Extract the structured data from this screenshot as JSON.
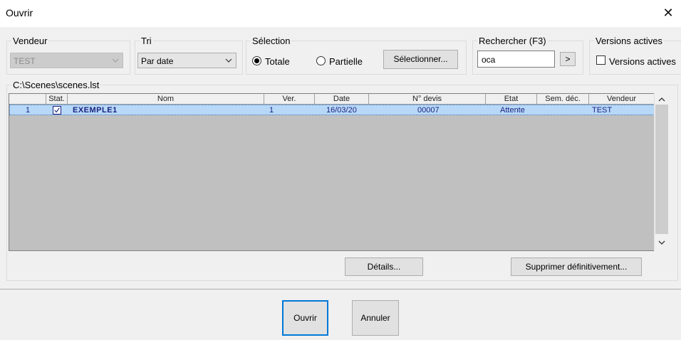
{
  "window": {
    "title": "Ouvrir"
  },
  "vendeur": {
    "label": "Vendeur",
    "value": "TEST"
  },
  "tri": {
    "label": "Tri",
    "value": "Par date"
  },
  "selection": {
    "label": "Sélection",
    "totale": "Totale",
    "partielle": "Partielle",
    "selected": "Totale",
    "button": "Sélectionner..."
  },
  "rechercher": {
    "label": "Rechercher (F3)",
    "value": "oca",
    "go": ">"
  },
  "versions": {
    "label": "Versions actives",
    "checkbox_label": "Versions actives",
    "checked": false
  },
  "list": {
    "path": "C:\\Scenes\\scenes.lst",
    "columns": [
      "Stat.",
      "Nom",
      "Ver.",
      "Date",
      "N° devis",
      "Etat",
      "Sem. déc.",
      "Vendeur"
    ],
    "rows": [
      {
        "index": "1",
        "stat_checked": true,
        "nom": "EXEMPLE1",
        "ver": "1",
        "date": "16/03/20",
        "devis": "00007",
        "etat": "Attente",
        "sem": "",
        "vendeur": "TEST"
      }
    ]
  },
  "buttons": {
    "details": "Détails...",
    "supprimer": "Supprimer définitivement...",
    "ouvrir": "Ouvrir",
    "annuler": "Annuler"
  },
  "icons": {
    "close": "close-icon",
    "chevron": "chevron-down-icon",
    "scroll_up": "scroll-up-icon",
    "scroll_down": "scroll-down-icon",
    "check": "check-icon"
  },
  "colors": {
    "selection_row": "#b8d8f8",
    "grid_bg": "#c0c0c0",
    "accent": "#0078d7"
  }
}
